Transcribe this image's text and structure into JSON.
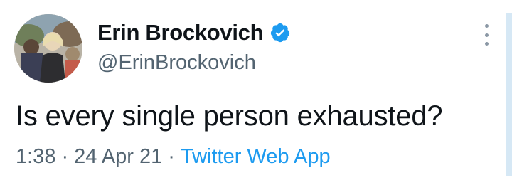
{
  "tweet": {
    "display_name": "Erin Brockovich",
    "handle": "@ErinBrockovich",
    "verified": true,
    "text": "Is every single person exhausted?",
    "time": "1:38",
    "separator": "·",
    "date": "24 Apr 21",
    "source": "Twitter Web App"
  },
  "icons": {
    "verified": "verified-badge-icon",
    "more": "more-vertical-icon"
  },
  "colors": {
    "primary_text": "#0f1419",
    "secondary_text": "#536471",
    "accent": "#1d9bf0"
  }
}
